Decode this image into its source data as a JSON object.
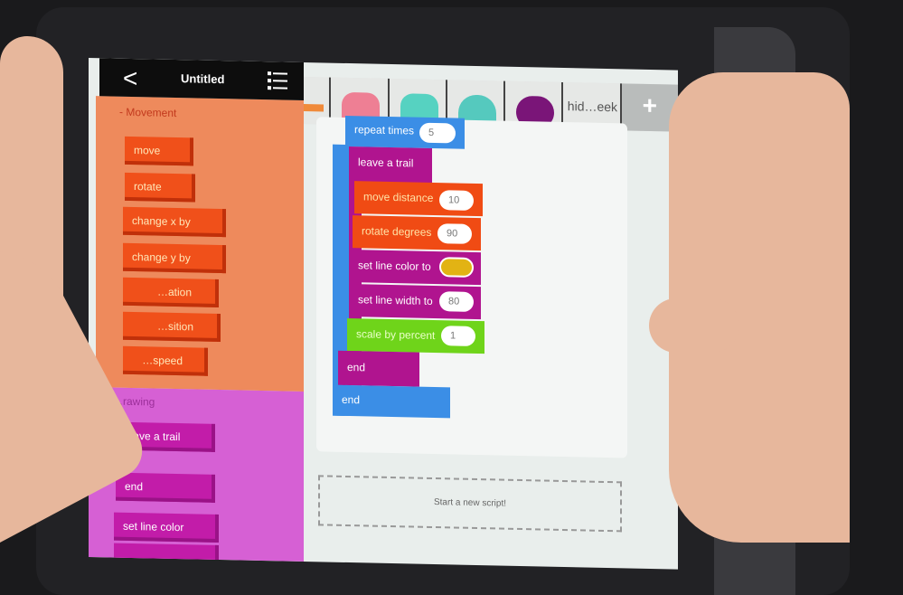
{
  "app": {
    "title": "Untitled",
    "back_label": "<",
    "back_icon": "chevron-left-icon",
    "menu_icon": "list-icon"
  },
  "palette": {
    "movement": {
      "label": "- Movement",
      "blocks": [
        "move",
        "rotate",
        "change x by",
        "change y by",
        "…ation",
        "…sition",
        "…speed"
      ]
    },
    "drawing": {
      "label": "…rawing",
      "blocks": [
        "leave a trail",
        "end",
        "set line color"
      ]
    }
  },
  "characters": {
    "tabs": [
      "character-1",
      "character-2",
      "character-3",
      "character-4",
      "character-5"
    ],
    "text_tab": "hid…eek",
    "add_label": "+"
  },
  "script": {
    "repeat": {
      "label": "repeat times",
      "value": "5"
    },
    "trail": {
      "label": "leave a trail"
    },
    "move": {
      "label": "move distance",
      "value": "10"
    },
    "rotate": {
      "label": "rotate degrees",
      "value": "90"
    },
    "color": {
      "label": "set line color to",
      "value_color": "#e2b314"
    },
    "width": {
      "label": "set line width to",
      "value": "80"
    },
    "scale": {
      "label": "scale by percent",
      "value": "1"
    },
    "inner_end": "end",
    "outer_end": "end"
  },
  "new_script": "Start a new script!",
  "colors": {
    "movement_block": "#f0501a",
    "drawing_block": "#c21ca9",
    "control_block": "#3b8ee6",
    "looks_block": "#6fd41a"
  }
}
